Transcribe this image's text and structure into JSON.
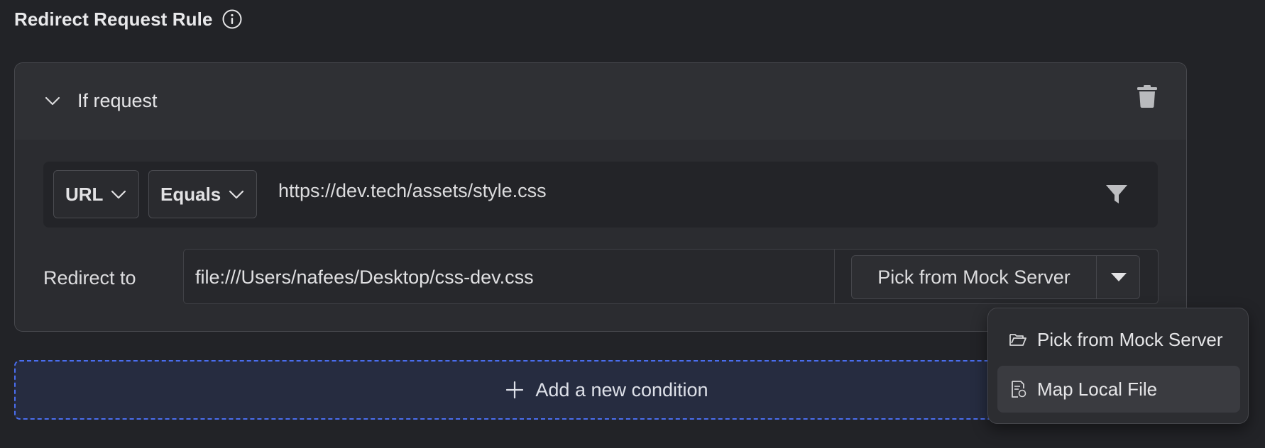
{
  "page": {
    "title": "Redirect Request Rule",
    "title_icon": "info-icon"
  },
  "rule": {
    "header": {
      "title": "If request",
      "expand_icon": "chevron-down-icon",
      "delete_icon": "trash-icon"
    },
    "condition": {
      "field": "URL",
      "operator": "Equals",
      "value": "https://dev.tech/assets/style.css",
      "filter_icon": "filter-icon"
    },
    "redirect": {
      "label": "Redirect to",
      "value": "file:///Users/nafees/Desktop/css-dev.css",
      "button_label": "Pick from Mock Server",
      "dropdown_icon": "caret-down-icon"
    }
  },
  "add_condition": {
    "label": "Add a new condition",
    "icon": "plus-icon"
  },
  "dropdown_menu": {
    "items": [
      {
        "label": "Pick from Mock Server",
        "icon": "folder-open-icon"
      },
      {
        "label": "Map Local File",
        "icon": "file-sync-icon"
      }
    ],
    "highlighted_index": 1
  },
  "colors": {
    "background": "#222327",
    "card": "#2b2c30",
    "accent_dashed": "#4a6ef0"
  }
}
